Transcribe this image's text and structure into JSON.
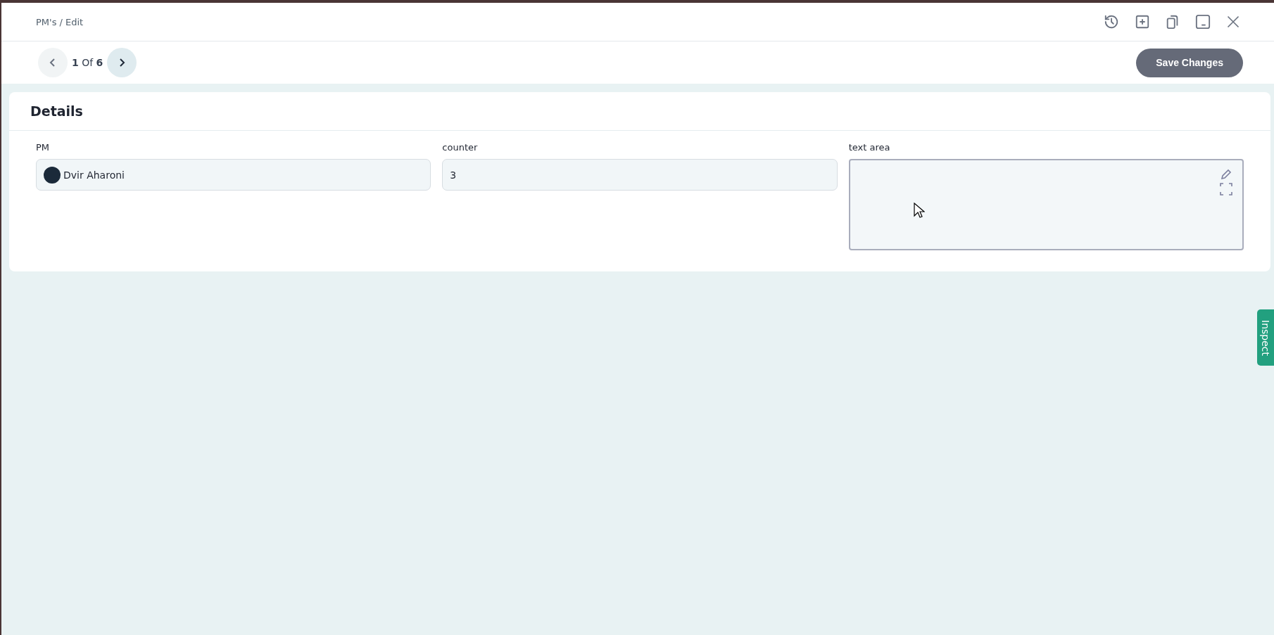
{
  "breadcrumb": "PM's / Edit",
  "pager": {
    "text": "**1** Of **6**"
  },
  "save_button": "Save Changes",
  "section": {
    "title": "Details"
  },
  "fields": [
    {
      "kind": "user",
      "label": "PM",
      "value": "Dvir Aharoni"
    },
    {
      "kind": "text",
      "label": "counter",
      "value": "3"
    },
    {
      "kind": "textarea",
      "label": "text area"
    }
  ],
  "side_tab": "Inspect"
}
